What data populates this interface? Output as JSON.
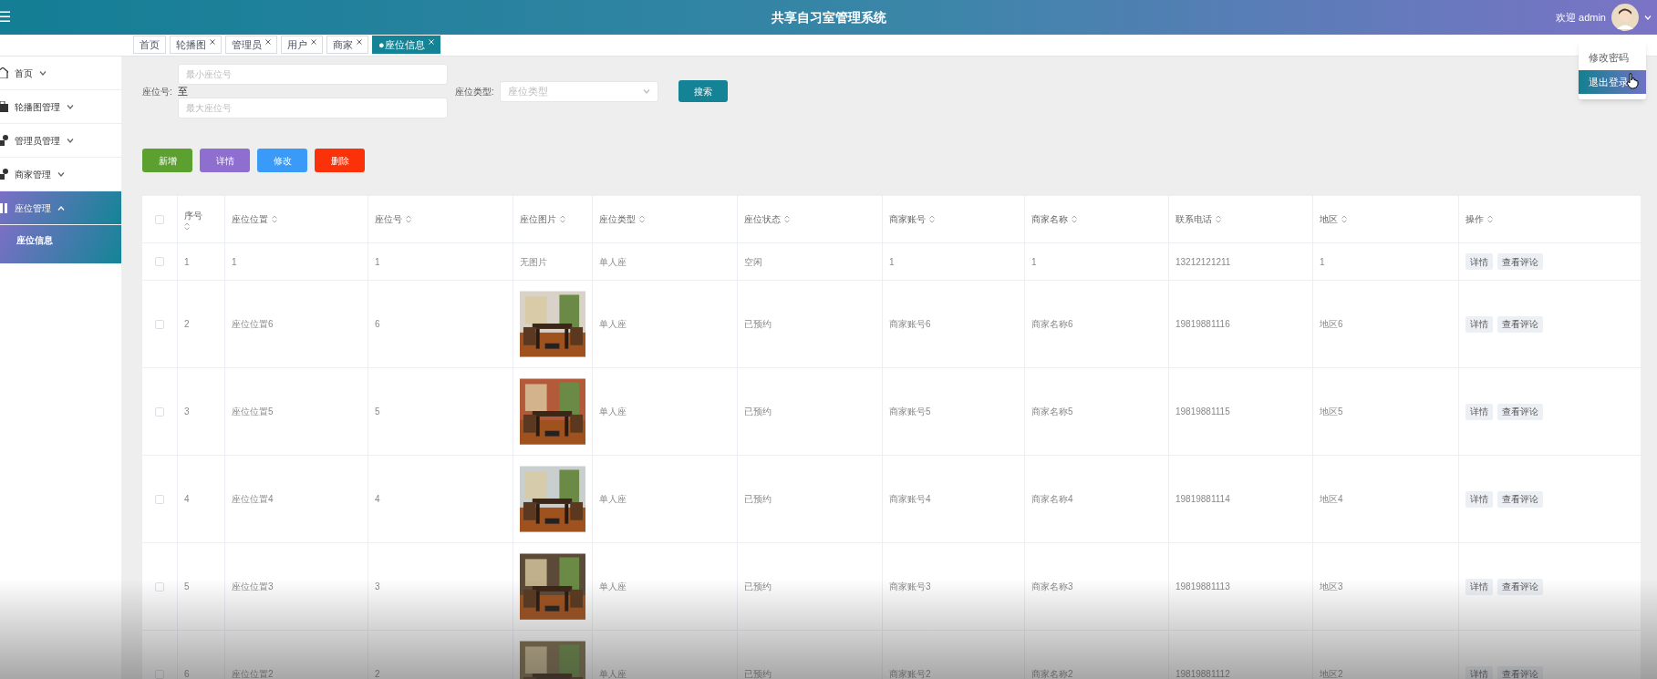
{
  "header": {
    "menu_icon": "☰",
    "title": "共享自习室管理系统",
    "welcome": "欢迎 admin"
  },
  "user_menu": {
    "items": [
      {
        "label": "修改密码",
        "selected": false
      },
      {
        "label": "退出登录",
        "selected": true
      }
    ]
  },
  "tabs": [
    {
      "label": "首页",
      "selected": false,
      "closable": false
    },
    {
      "label": "轮播图",
      "selected": false,
      "closable": true
    },
    {
      "label": "管理员",
      "selected": false,
      "closable": true
    },
    {
      "label": "用户",
      "selected": false,
      "closable": true
    },
    {
      "label": "商家",
      "selected": false,
      "closable": true
    },
    {
      "label": "●座位信息",
      "selected": true,
      "closable": true
    }
  ],
  "sidebar": {
    "items": [
      {
        "label": "首页",
        "expanded": false,
        "selected": false
      },
      {
        "label": "轮播图管理",
        "expanded": false,
        "selected": false
      },
      {
        "label": "管理员管理",
        "expanded": false,
        "selected": false
      },
      {
        "label": "商家管理",
        "expanded": false,
        "selected": false
      },
      {
        "label": "座位管理",
        "expanded": true,
        "selected": true,
        "children": [
          {
            "label": "座位信息",
            "selected": true
          }
        ]
      }
    ]
  },
  "search": {
    "seat_no_label": "座位号:",
    "min_placeholder": "最小座位号",
    "range_word": "至",
    "max_placeholder": "最大座位号",
    "type_label": "座位类型:",
    "type_placeholder": "座位类型",
    "button": "搜索"
  },
  "actions": [
    {
      "label": "新增",
      "color": "#5ca12f"
    },
    {
      "label": "详情",
      "color": "#8e6fd0"
    },
    {
      "label": "修改",
      "color": "#3a9af7"
    },
    {
      "label": "删除",
      "color": "#fb3209"
    }
  ],
  "table": {
    "select_all_checked": false,
    "columns": [
      "序号",
      "座位位置",
      "座位号",
      "座位图片",
      "座位类型",
      "座位状态",
      "商家账号",
      "商家名称",
      "联系电话",
      "地区",
      "操作"
    ],
    "rows": [
      {
        "checked": false,
        "cells": [
          "1",
          "1",
          "1",
          {
            "kind": "text",
            "text": "无图片"
          },
          "单人座",
          "空闲",
          "1",
          "1",
          "13212121211",
          "1"
        ],
        "buttons": [
          "详情",
          "查看评论"
        ]
      },
      {
        "checked": false,
        "cells": [
          "2",
          "座位位置6",
          "6",
          {
            "kind": "picture"
          },
          "单人座",
          "已预约",
          "商家账号6",
          "商家名称6",
          "19819881116",
          "地区6"
        ],
        "buttons": [
          "详情",
          "查看评论"
        ]
      },
      {
        "checked": false,
        "cells": [
          "3",
          "座位位置5",
          "5",
          {
            "kind": "picture"
          },
          "单人座",
          "已预约",
          "商家账号5",
          "商家名称5",
          "19819881115",
          "地区5"
        ],
        "buttons": [
          "详情",
          "查看评论"
        ]
      },
      {
        "checked": false,
        "cells": [
          "4",
          "座位位置4",
          "4",
          {
            "kind": "picture"
          },
          "单人座",
          "已预约",
          "商家账号4",
          "商家名称4",
          "19819881114",
          "地区4"
        ],
        "buttons": [
          "详情",
          "查看评论"
        ]
      },
      {
        "checked": false,
        "cells": [
          "5",
          "座位位置3",
          "3",
          {
            "kind": "picture"
          },
          "单人座",
          "已预约",
          "商家账号3",
          "商家名称3",
          "19819881113",
          "地区3"
        ],
        "buttons": [
          "详情",
          "查看评论"
        ]
      },
      {
        "checked": false,
        "cells": [
          "6",
          "座位位置2",
          "2",
          {
            "kind": "picture"
          },
          "单人座",
          "已预约",
          "商家账号2",
          "商家名称2",
          "19819881112",
          "地区2"
        ],
        "buttons": [
          "详情",
          "查看评论"
        ]
      }
    ]
  }
}
